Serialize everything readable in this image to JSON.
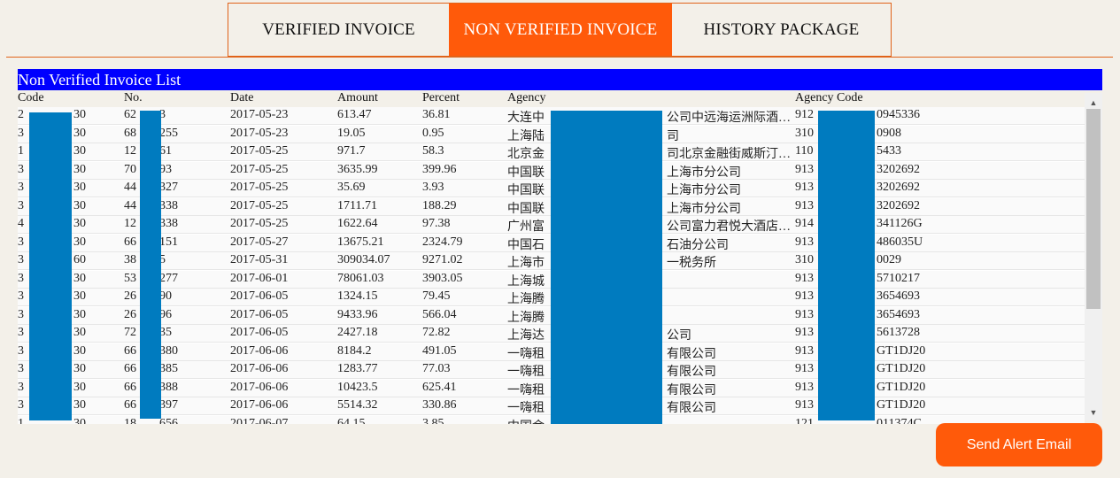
{
  "tabs": [
    {
      "label": "VERIFIED INVOICE",
      "active": false
    },
    {
      "label": "NON VERIFIED INVOICE",
      "active": true
    },
    {
      "label": "HISTORY PACKAGE",
      "active": false
    }
  ],
  "list": {
    "title": "Non Verified Invoice List",
    "columns": {
      "code": "Code",
      "no": "No.",
      "date": "Date",
      "amount": "Amount",
      "percent": "Percent",
      "agency": "Agency",
      "agency_code": "Agency Code"
    },
    "rows": [
      {
        "code1": "2",
        "code2": "30",
        "no1": "62",
        "no2": "3",
        "date": "2017-05-23",
        "amount": "613.47",
        "percent": "36.81",
        "agency1": "大连中",
        "agency2": "公司中远海运洲际酒…",
        "acode1": "912",
        "acode2": "0945336"
      },
      {
        "code1": "3",
        "code2": "30",
        "no1": "68",
        "no2": "255",
        "date": "2017-05-23",
        "amount": "19.05",
        "percent": "0.95",
        "agency1": "上海陆",
        "agency2": "司",
        "acode1": "310",
        "acode2": "0908"
      },
      {
        "code1": "1",
        "code2": "30",
        "no1": "12",
        "no2": "61",
        "date": "2017-05-25",
        "amount": "971.7",
        "percent": "58.3",
        "agency1": "北京金",
        "agency2": "司北京金融街威斯汀…",
        "acode1": "110",
        "acode2": "5433"
      },
      {
        "code1": "3",
        "code2": "30",
        "no1": "70",
        "no2": "93",
        "date": "2017-05-25",
        "amount": "3635.99",
        "percent": "399.96",
        "agency1": "中国联",
        "agency2": "上海市分公司",
        "acode1": "913",
        "acode2": "3202692"
      },
      {
        "code1": "3",
        "code2": "30",
        "no1": "44",
        "no2": "327",
        "date": "2017-05-25",
        "amount": "35.69",
        "percent": "3.93",
        "agency1": "中国联",
        "agency2": "上海市分公司",
        "acode1": "913",
        "acode2": "3202692"
      },
      {
        "code1": "3",
        "code2": "30",
        "no1": "44",
        "no2": "338",
        "date": "2017-05-25",
        "amount": "1711.71",
        "percent": "188.29",
        "agency1": "中国联",
        "agency2": "上海市分公司",
        "acode1": "913",
        "acode2": "3202692"
      },
      {
        "code1": "4",
        "code2": "30",
        "no1": "12",
        "no2": "338",
        "date": "2017-05-25",
        "amount": "1622.64",
        "percent": "97.38",
        "agency1": "广州富",
        "agency2": "公司富力君悦大酒店…",
        "acode1": "914",
        "acode2": "341126G"
      },
      {
        "code1": "3",
        "code2": "30",
        "no1": "66",
        "no2": "151",
        "date": "2017-05-27",
        "amount": "13675.21",
        "percent": "2324.79",
        "agency1": "中国石",
        "agency2": "石油分公司",
        "acode1": "913",
        "acode2": "486035U"
      },
      {
        "code1": "3",
        "code2": "60",
        "no1": "38",
        "no2": "5",
        "date": "2017-05-31",
        "amount": "309034.07",
        "percent": "9271.02",
        "agency1": "上海市",
        "agency2": "一税务所",
        "acode1": "310",
        "acode2": "0029"
      },
      {
        "code1": "3",
        "code2": "30",
        "no1": "53",
        "no2": "277",
        "date": "2017-06-01",
        "amount": "78061.03",
        "percent": "3903.05",
        "agency1": "上海城",
        "agency2": "",
        "acode1": "913",
        "acode2": "5710217"
      },
      {
        "code1": "3",
        "code2": "30",
        "no1": "26",
        "no2": "90",
        "date": "2017-06-05",
        "amount": "1324.15",
        "percent": "79.45",
        "agency1": "上海腾",
        "agency2": "",
        "acode1": "913",
        "acode2": "3654693"
      },
      {
        "code1": "3",
        "code2": "30",
        "no1": "26",
        "no2": "96",
        "date": "2017-06-05",
        "amount": "9433.96",
        "percent": "566.04",
        "agency1": "上海腾",
        "agency2": "",
        "acode1": "913",
        "acode2": "3654693"
      },
      {
        "code1": "3",
        "code2": "30",
        "no1": "72",
        "no2": "35",
        "date": "2017-06-05",
        "amount": "2427.18",
        "percent": "72.82",
        "agency1": "上海达",
        "agency2": "公司",
        "acode1": "913",
        "acode2": "5613728"
      },
      {
        "code1": "3",
        "code2": "30",
        "no1": "66",
        "no2": "380",
        "date": "2017-06-06",
        "amount": "8184.2",
        "percent": "491.05",
        "agency1": "一嗨租",
        "agency2": "有限公司",
        "acode1": "913",
        "acode2": "GT1DJ20"
      },
      {
        "code1": "3",
        "code2": "30",
        "no1": "66",
        "no2": "385",
        "date": "2017-06-06",
        "amount": "1283.77",
        "percent": "77.03",
        "agency1": "一嗨租",
        "agency2": "有限公司",
        "acode1": "913",
        "acode2": "GT1DJ20"
      },
      {
        "code1": "3",
        "code2": "30",
        "no1": "66",
        "no2": "388",
        "date": "2017-06-06",
        "amount": "10423.5",
        "percent": "625.41",
        "agency1": "一嗨租",
        "agency2": "有限公司",
        "acode1": "913",
        "acode2": "GT1DJ20"
      },
      {
        "code1": "3",
        "code2": "30",
        "no1": "66",
        "no2": "397",
        "date": "2017-06-06",
        "amount": "5514.32",
        "percent": "330.86",
        "agency1": "一嗨租",
        "agency2": "有限公司",
        "acode1": "913",
        "acode2": "GT1DJ20"
      },
      {
        "code1": "1",
        "code2": "30",
        "no1": "18",
        "no2": "656",
        "date": "2017-06-07",
        "amount": "64.15",
        "percent": "3.85",
        "agency1": "中国金",
        "agency2": "",
        "acode1": "121",
        "acode2": "011374C"
      }
    ]
  },
  "actions": {
    "send_alert_label": "Send Alert Email"
  },
  "colors": {
    "accent": "#ff5a0a",
    "title_bar": "#0000ff",
    "redaction": "#007bbf"
  }
}
